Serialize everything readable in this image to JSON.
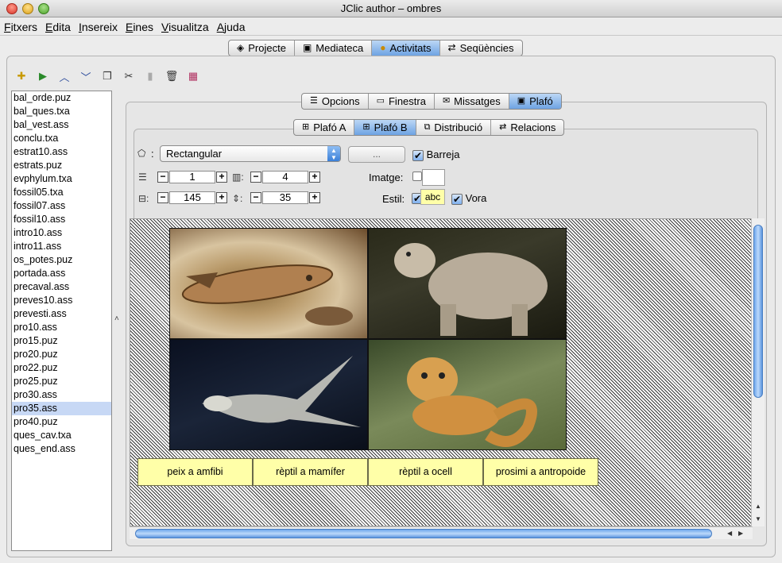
{
  "window": {
    "title": "JClic author – ombres"
  },
  "menu": [
    "Fitxers",
    "Edita",
    "Insereix",
    "Eines",
    "Visualitza",
    "Ajuda"
  ],
  "main_tabs": [
    {
      "label": "Projecte",
      "icon": "project-icon"
    },
    {
      "label": "Mediateca",
      "icon": "media-library-icon"
    },
    {
      "label": "Activitats",
      "icon": "activities-icon",
      "active": true
    },
    {
      "label": "Seqüències",
      "icon": "sequences-icon"
    }
  ],
  "activity_tabs": [
    {
      "label": "Opcions"
    },
    {
      "label": "Finestra"
    },
    {
      "label": "Missatges"
    },
    {
      "label": "Plafó",
      "active": true
    }
  ],
  "panel_tabs": [
    {
      "label": "Plafó A"
    },
    {
      "label": "Plafó B",
      "active": true
    },
    {
      "label": "Distribució"
    },
    {
      "label": "Relacions"
    }
  ],
  "files": [
    "bal_orde.puz",
    "bal_ques.txa",
    "bal_vest.ass",
    "conclu.txa",
    "estrat10.ass",
    "estrats.puz",
    "evphylum.txa",
    "fossil05.txa",
    "fossil07.ass",
    "fossil10.ass",
    "intro10.ass",
    "intro11.ass",
    "os_potes.puz",
    "portada.ass",
    "precaval.ass",
    "preves10.ass",
    "prevesti.ass",
    "pro10.ass",
    "pro15.puz",
    "pro20.puz",
    "pro22.puz",
    "pro25.puz",
    "pro30.ass",
    "pro35.ass",
    "pro40.puz",
    "ques_cav.txa",
    "ques_end.ass"
  ],
  "selected_file": "pro35.ass",
  "shape": {
    "label": ":",
    "value": "Rectangular"
  },
  "dots_button": "...",
  "shuffle": {
    "label": "Barreja",
    "checked": true
  },
  "rows": {
    "value": "1"
  },
  "cols": {
    "value": "4"
  },
  "cell_width": {
    "value": "145"
  },
  "cell_height": {
    "value": "35"
  },
  "image": {
    "label": "Imatge:"
  },
  "style": {
    "label": "Estil:",
    "sample": "abc"
  },
  "border": {
    "label": "Vora",
    "checked": true
  },
  "cells": [
    "peix a amfibi",
    "rèptil a mamífer",
    "rèptil a ocell",
    "prosimi a antropoide"
  ],
  "colors": {
    "cell_bg": "#ffffa8",
    "active_tab": "#6ea3e3"
  }
}
